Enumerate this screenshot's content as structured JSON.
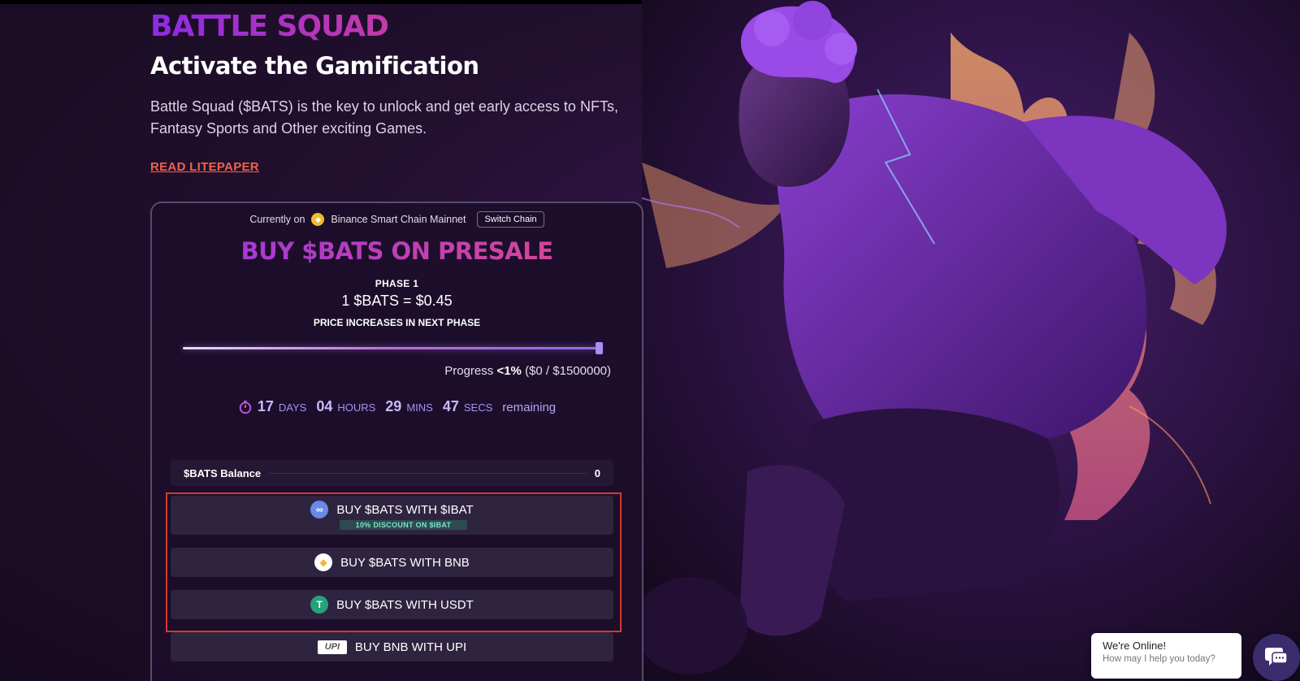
{
  "brand": "BATTLE SQUAD",
  "hero": {
    "tagline": "Activate the Gamification",
    "description": "Battle Squad ($BATS) is the key to unlock and get early access to NFTs, Fantasy Sports and Other exciting Games.",
    "litepaper_link": "READ LITEPAPER"
  },
  "presale": {
    "chain_prefix": "Currently on",
    "chain_name": "Binance Smart Chain Mainnet",
    "switch_chain_label": "Switch Chain",
    "title": "BUY $BATS ON PRESALE",
    "phase": "PHASE 1",
    "price": "1 $BATS = $0.45",
    "price_note": "PRICE INCREASES IN NEXT PHASE",
    "progress_label": "Progress",
    "progress_percent": "<1%",
    "progress_amount": "($0 / $1500000)",
    "progress_fraction": 0.0,
    "countdown": {
      "days": "17",
      "days_label": "DAYS",
      "hours": "04",
      "hours_label": "HOURS",
      "mins": "29",
      "mins_label": "MINS",
      "secs": "47",
      "secs_label": "SECS",
      "remaining": "remaining"
    },
    "balance_label": "$BATS Balance",
    "balance_value": "0",
    "buy_ibat_label": "BUY $BATS WITH $IBAT",
    "buy_ibat_discount": "10% DISCOUNT ON $IBAT",
    "buy_bnb_label": "BUY $BATS WITH BNB",
    "buy_usdt_label": "BUY $BATS WITH USDT",
    "buy_upi_label": "BUY BNB WITH UPI",
    "upi_logo_text": "UPI"
  },
  "chat": {
    "title": "We're Online!",
    "subtitle": "How may I help you today?"
  },
  "colors": {
    "accent_purple": "#8c2be2",
    "accent_pink": "#e0418f",
    "link_orange": "#f0624a",
    "highlight_red": "#d53a2e",
    "bnb_yellow": "#f3ba2f",
    "usdt_green": "#26a17b"
  },
  "icons": {
    "chain": "bnb-icon",
    "timer": "stopwatch-icon",
    "ibat": "ibat-coin-icon",
    "bnb": "bnb-coin-icon",
    "usdt": "usdt-coin-icon",
    "upi": "upi-logo-icon",
    "chat": "chat-icon"
  }
}
